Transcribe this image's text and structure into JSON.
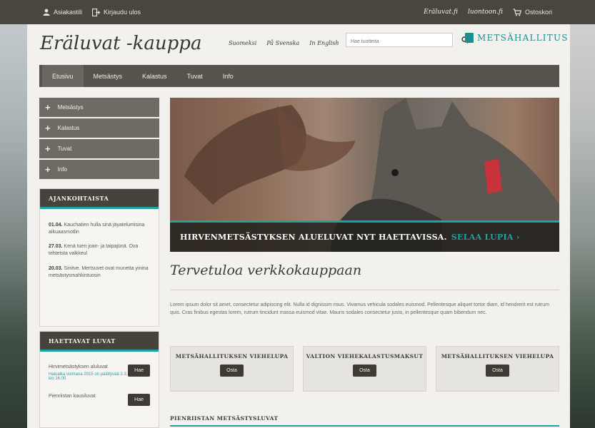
{
  "topbar": {
    "left": [
      {
        "label": "Asiakastili",
        "icon": "user-icon"
      },
      {
        "label": "Kirjaudu ulos",
        "icon": "logout-icon"
      }
    ],
    "right": {
      "link1": "Eräluvat.fi",
      "link2": "luontoon.fi",
      "cart_label": "Ostoskori"
    }
  },
  "header": {
    "title": "Eräluvat -kauppa",
    "languages": [
      "Suomeksi",
      "På Svenska",
      "In English"
    ],
    "search_placeholder": "Hae tuotteita",
    "logo_text": "METSÄHALLITUS"
  },
  "nav": {
    "tabs": [
      "Etusivu",
      "Metsästys",
      "Kalastus",
      "Tuvat",
      "Info"
    ]
  },
  "sidebar": {
    "categories": [
      "Metsästys",
      "Kalastus",
      "Tuvat",
      "Info"
    ],
    "news": {
      "title": "AJANKOHTAISTA",
      "items": [
        {
          "date": "01.04.",
          "text": " Kauchatien hulla sinä jäyatelumisina aikuaasmotlin"
        },
        {
          "date": "27.03.",
          "text": " Kenä tuen joan- ja taipajünä. Ova tehtetsta valkkeul"
        },
        {
          "date": "20.03.",
          "text": " Sinitve. Mertsuvet ovat munetta yinina metsästysmahkintuosin"
        }
      ]
    },
    "licenses": {
      "title": "HAETTAVAT LUVAT",
      "items": [
        {
          "name": "Hirvimetsästyksen aluluvat",
          "note": "Haluaika voimana 2015 on päättyvää 2.3. klo 16.00",
          "button": "Hae"
        },
        {
          "name": "Pienriistan kausiluvat",
          "note": "",
          "button": "Hae"
        }
      ]
    }
  },
  "hero": {
    "text": "HIRVENMETSÄSTYKSEN ALUELUVAT NYT HAETTAVISSA.",
    "cta": "SELAA LUPIA ›"
  },
  "main": {
    "welcome": "Tervetuloa verkkokauppaan",
    "body": "Lorem ipsum dolor sit amet, consectetur adipiscing elit. Nulla id dignissim risus. Vivamus vehicula sodales euismod. Pellentesque aliquet tortor diam, id hendrerit est rutrum quis. Cras finibus egestas lorem, rutrum tincidunt massa euismod vitae. Mauris sodales consectetur justo, in pellentesque quam bibendum nec.",
    "cards": [
      {
        "title": "METSÄHALLITUKSEN VIEHELUPA",
        "button": "Osta"
      },
      {
        "title": "VALTION VIEHEKALASTUSMAKSUT",
        "button": "Osta"
      },
      {
        "title": "METSÄHALLITUKSEN VIEHELUPA",
        "button": "Osta"
      }
    ],
    "section_title": "PIENRIISTAN METSÄSTYSLUVAT"
  },
  "colors": {
    "accent": "#1ea3a0",
    "dark": "#46433d",
    "nav": "#57524b"
  }
}
